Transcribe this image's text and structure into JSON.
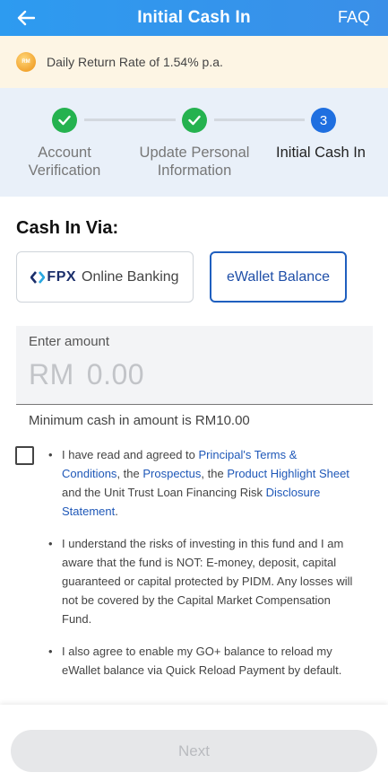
{
  "header": {
    "title": "Initial Cash In",
    "faq_label": "FAQ",
    "back_icon": "arrow-left-icon",
    "background": "#2d9bf0"
  },
  "rate_banner": {
    "text": "Daily Return Rate of 1.54% p.a.",
    "coin_text": "RM",
    "background": "#fdf5e4"
  },
  "stepper": {
    "steps": [
      {
        "label": "Account\nVerification",
        "status": "done"
      },
      {
        "label": "Update Personal\nInformation",
        "status": "done"
      },
      {
        "label": "Initial Cash In",
        "status": "active",
        "number": "3"
      }
    ],
    "done_color": "#25b24f",
    "active_color": "#1f6fe0"
  },
  "cash_in": {
    "title": "Cash In Via:",
    "options": [
      {
        "logo": "FPX",
        "label": "Online Banking",
        "selected": false
      },
      {
        "label": "eWallet Balance",
        "selected": true
      }
    ],
    "accent": "#1f5fbf"
  },
  "amount": {
    "label": "Enter amount",
    "currency": "RM",
    "value": "0.00",
    "min_text": "Minimum cash in amount is RM10.00"
  },
  "terms": {
    "checked": false,
    "items": [
      {
        "p1": "I have read and agreed to ",
        "link1": "Principal's Terms & Conditions",
        "p2": ", the ",
        "link2": "Prospectus",
        "p3": ", the ",
        "link3": "Product Highlight Sheet",
        "p4": " and the Unit Trust Loan Financing Risk ",
        "link4": "Disclosure Statement",
        "p5": "."
      },
      {
        "text": "I understand the risks of investing in this fund and I am aware that the fund is NOT: E-money, deposit, capital guaranteed or capital protected by PIDM. Any losses will not be covered by the Capital Market Compensation Fund."
      },
      {
        "text": "I also agree to enable my GO+ balance to reload my eWallet balance via Quick Reload Payment by default."
      }
    ],
    "link_color": "#1f58b8"
  },
  "footer": {
    "next_label": "Next",
    "next_enabled": false
  }
}
